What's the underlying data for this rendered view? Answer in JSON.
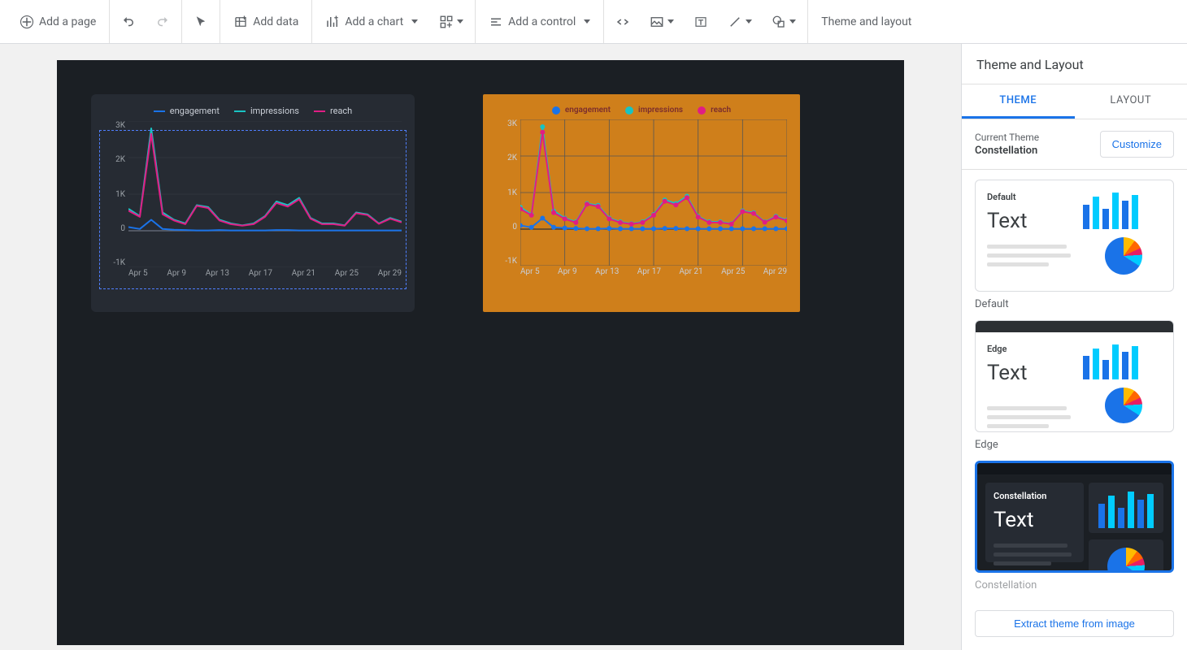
{
  "toolbar": {
    "add_page": "Add a page",
    "add_data": "Add data",
    "add_chart": "Add a chart",
    "add_control": "Add a control",
    "theme_layout": "Theme and layout"
  },
  "chart_data": [
    {
      "type": "line",
      "theme": "dark",
      "selected": true,
      "x": [
        "Apr 5",
        "Apr 6",
        "Apr 7",
        "Apr 8",
        "Apr 9",
        "Apr 10",
        "Apr 11",
        "Apr 12",
        "Apr 13",
        "Apr 14",
        "Apr 15",
        "Apr 16",
        "Apr 17",
        "Apr 18",
        "Apr 19",
        "Apr 20",
        "Apr 21",
        "Apr 22",
        "Apr 23",
        "Apr 24",
        "Apr 25",
        "Apr 26",
        "Apr 27",
        "Apr 28",
        "Apr 29"
      ],
      "x_ticks": [
        "Apr 5",
        "Apr 9",
        "Apr 13",
        "Apr 17",
        "Apr 21",
        "Apr 25",
        "Apr 29"
      ],
      "series": [
        {
          "name": "engagement",
          "color": "#1a73e8",
          "values": [
            100,
            50,
            300,
            50,
            30,
            20,
            10,
            10,
            20,
            10,
            10,
            10,
            10,
            20,
            20,
            10,
            10,
            10,
            10,
            10,
            10,
            10,
            10,
            10,
            10
          ]
        },
        {
          "name": "impressions",
          "color": "#19c3c3",
          "values": [
            600,
            400,
            2800,
            500,
            300,
            200,
            700,
            650,
            300,
            200,
            150,
            200,
            400,
            800,
            700,
            900,
            350,
            200,
            200,
            150,
            500,
            450,
            200,
            350,
            250
          ]
        },
        {
          "name": "reach",
          "color": "#e01d84",
          "values": [
            550,
            380,
            2650,
            450,
            280,
            180,
            680,
            620,
            280,
            180,
            140,
            180,
            380,
            760,
            660,
            860,
            330,
            180,
            180,
            140,
            480,
            430,
            190,
            330,
            230
          ]
        }
      ],
      "ylim": [
        -1000,
        3000
      ],
      "y_ticks": [
        "3K",
        "2K",
        "1K",
        "0",
        "-1K"
      ]
    },
    {
      "type": "line",
      "theme": "orange",
      "markers": true,
      "x": [
        "Apr 5",
        "Apr 6",
        "Apr 7",
        "Apr 8",
        "Apr 9",
        "Apr 10",
        "Apr 11",
        "Apr 12",
        "Apr 13",
        "Apr 14",
        "Apr 15",
        "Apr 16",
        "Apr 17",
        "Apr 18",
        "Apr 19",
        "Apr 20",
        "Apr 21",
        "Apr 22",
        "Apr 23",
        "Apr 24",
        "Apr 25",
        "Apr 26",
        "Apr 27",
        "Apr 28",
        "Apr 29"
      ],
      "x_ticks": [
        "Apr 5",
        "Apr 9",
        "Apr 13",
        "Apr 17",
        "Apr 21",
        "Apr 25",
        "Apr 29"
      ],
      "series": [
        {
          "name": "engagement",
          "color": "#1a73e8",
          "values": [
            100,
            50,
            300,
            50,
            30,
            20,
            10,
            10,
            20,
            10,
            10,
            10,
            10,
            20,
            20,
            10,
            10,
            10,
            10,
            10,
            10,
            10,
            10,
            10,
            10
          ]
        },
        {
          "name": "impressions",
          "color": "#19c3c3",
          "values": [
            600,
            400,
            2800,
            500,
            300,
            200,
            700,
            650,
            300,
            200,
            150,
            200,
            400,
            800,
            700,
            900,
            350,
            200,
            200,
            150,
            500,
            450,
            200,
            350,
            250
          ]
        },
        {
          "name": "reach",
          "color": "#e01d84",
          "values": [
            550,
            380,
            2650,
            450,
            280,
            180,
            680,
            620,
            280,
            180,
            140,
            180,
            380,
            760,
            660,
            860,
            330,
            180,
            180,
            140,
            480,
            430,
            190,
            330,
            230
          ]
        }
      ],
      "ylim": [
        -1000,
        3000
      ],
      "y_ticks": [
        "3K",
        "2K",
        "1K",
        "0",
        "-1K"
      ]
    }
  ],
  "sidebar": {
    "title": "Theme and Layout",
    "tabs": {
      "theme": "THEME",
      "layout": "LAYOUT"
    },
    "current_label": "Current Theme",
    "current_value": "Constellation",
    "customize": "Customize",
    "themes": [
      {
        "id": "default",
        "name": "Default",
        "text": "Text"
      },
      {
        "id": "edge",
        "name": "Edge",
        "text": "Text"
      },
      {
        "id": "constellation",
        "name": "Constellation",
        "text": "Text"
      }
    ],
    "extract": "Extract theme from image"
  }
}
